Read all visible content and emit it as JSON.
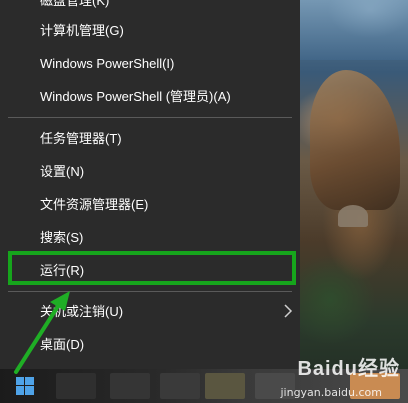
{
  "menu": {
    "items": [
      {
        "label": "磁盘管理(K)"
      },
      {
        "label": "计算机管理(G)"
      },
      {
        "label": "Windows PowerShell(I)"
      },
      {
        "label": "Windows PowerShell (管理员)(A)"
      },
      {
        "label": "任务管理器(T)"
      },
      {
        "label": "设置(N)"
      },
      {
        "label": "文件资源管理器(E)"
      },
      {
        "label": "搜索(S)"
      },
      {
        "label": "运行(R)"
      },
      {
        "label": "关机或注销(U)"
      },
      {
        "label": "桌面(D)"
      }
    ],
    "highlighted_item": "运行(R)"
  },
  "watermark": {
    "text": "Baidu经验",
    "url": "jingyan.baidu.com"
  },
  "colors": {
    "menu_bg": "#2b2b2b",
    "highlight_border": "#16a51c",
    "arrow": "#1fae25",
    "start_icon": "#4fa3e8"
  },
  "icons": {
    "start": "windows-logo-icon",
    "submenu": "chevron-right-icon",
    "annotation": "green-arrow-icon"
  }
}
